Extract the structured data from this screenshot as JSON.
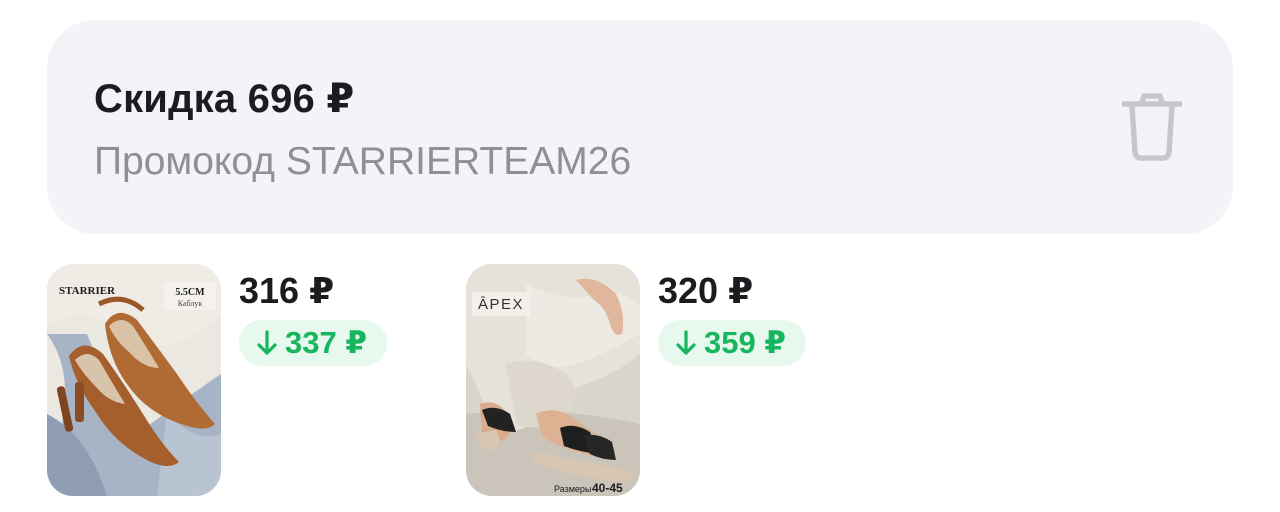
{
  "promo": {
    "title": "Скидка 696 ₽",
    "code_text": "Промокод STARRIERTEAM26",
    "delete_icon": "trash-icon"
  },
  "products": [
    {
      "price": "316 ₽",
      "old_price": "337 ₽",
      "arrow_icon": "arrow-down-icon",
      "image": {
        "brand": "STARRIER",
        "badge_main": "5.5CM",
        "badge_sub": "Каблук",
        "description": "brown leather slingback pointed-toe heels on denim"
      }
    },
    {
      "price": "320 ₽",
      "old_price": "359 ₽",
      "arrow_icon": "arrow-down-icon",
      "image": {
        "brand": "ĀPEX",
        "size_label": "Размеры",
        "size_value": "40-45",
        "description": "black two-strap slide sandals on feet, beige trousers"
      }
    }
  ],
  "colors": {
    "card_bg": "#f3f3f8",
    "title": "#1c1c20",
    "muted": "#8f8f99",
    "discount_green": "#17b55d",
    "discount_bg": "#e7f8ef"
  }
}
